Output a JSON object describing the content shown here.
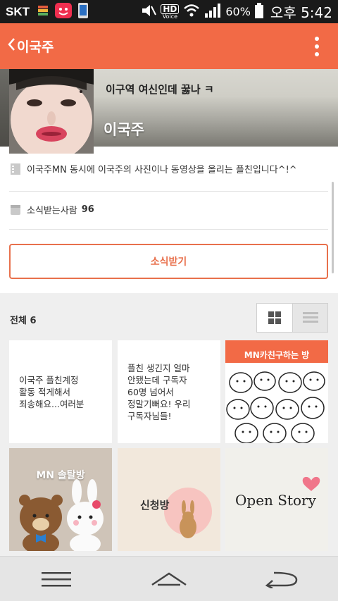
{
  "status_bar": {
    "carrier": "SKT",
    "hd_badge": "HD",
    "voice_label": "Voice",
    "battery_percent": "60%",
    "time": "오후 5:42"
  },
  "app_bar": {
    "title": "이국주",
    "back_icon": "chevron-left-icon",
    "menu_icon": "more-vertical-icon"
  },
  "profile": {
    "cover_caption": "이구역 여신인데 꿇나 ㅋ",
    "name": "이국주",
    "description": "이국주MN 동시에 이국주의 사진이나 동영상을 올리는 플친입니다^!^",
    "subscribers_label": "소식받는사람",
    "subscribers_count": "96",
    "subscribe_button": "소식받기"
  },
  "posts": {
    "total_label": "전체 6",
    "view_modes": [
      "grid",
      "list"
    ],
    "active_view": "grid",
    "items": [
      {
        "type": "text",
        "text": "이국주 플친계정\n활동 적게해서\n죄송해요...여러분"
      },
      {
        "type": "text",
        "text": "플친 생긴지 얼마\n안됐는데 구독자\n60명 넘어서\n정말기뻐요! 우리\n구독자님들!"
      },
      {
        "type": "image",
        "label": "MN카친구하는 방"
      },
      {
        "type": "image",
        "label": "MN 솔탈방"
      },
      {
        "type": "image",
        "label": "신청방"
      },
      {
        "type": "image",
        "label": "Open Story"
      }
    ]
  },
  "colors": {
    "accent": "#f26a46",
    "button_border": "#e8704c"
  }
}
